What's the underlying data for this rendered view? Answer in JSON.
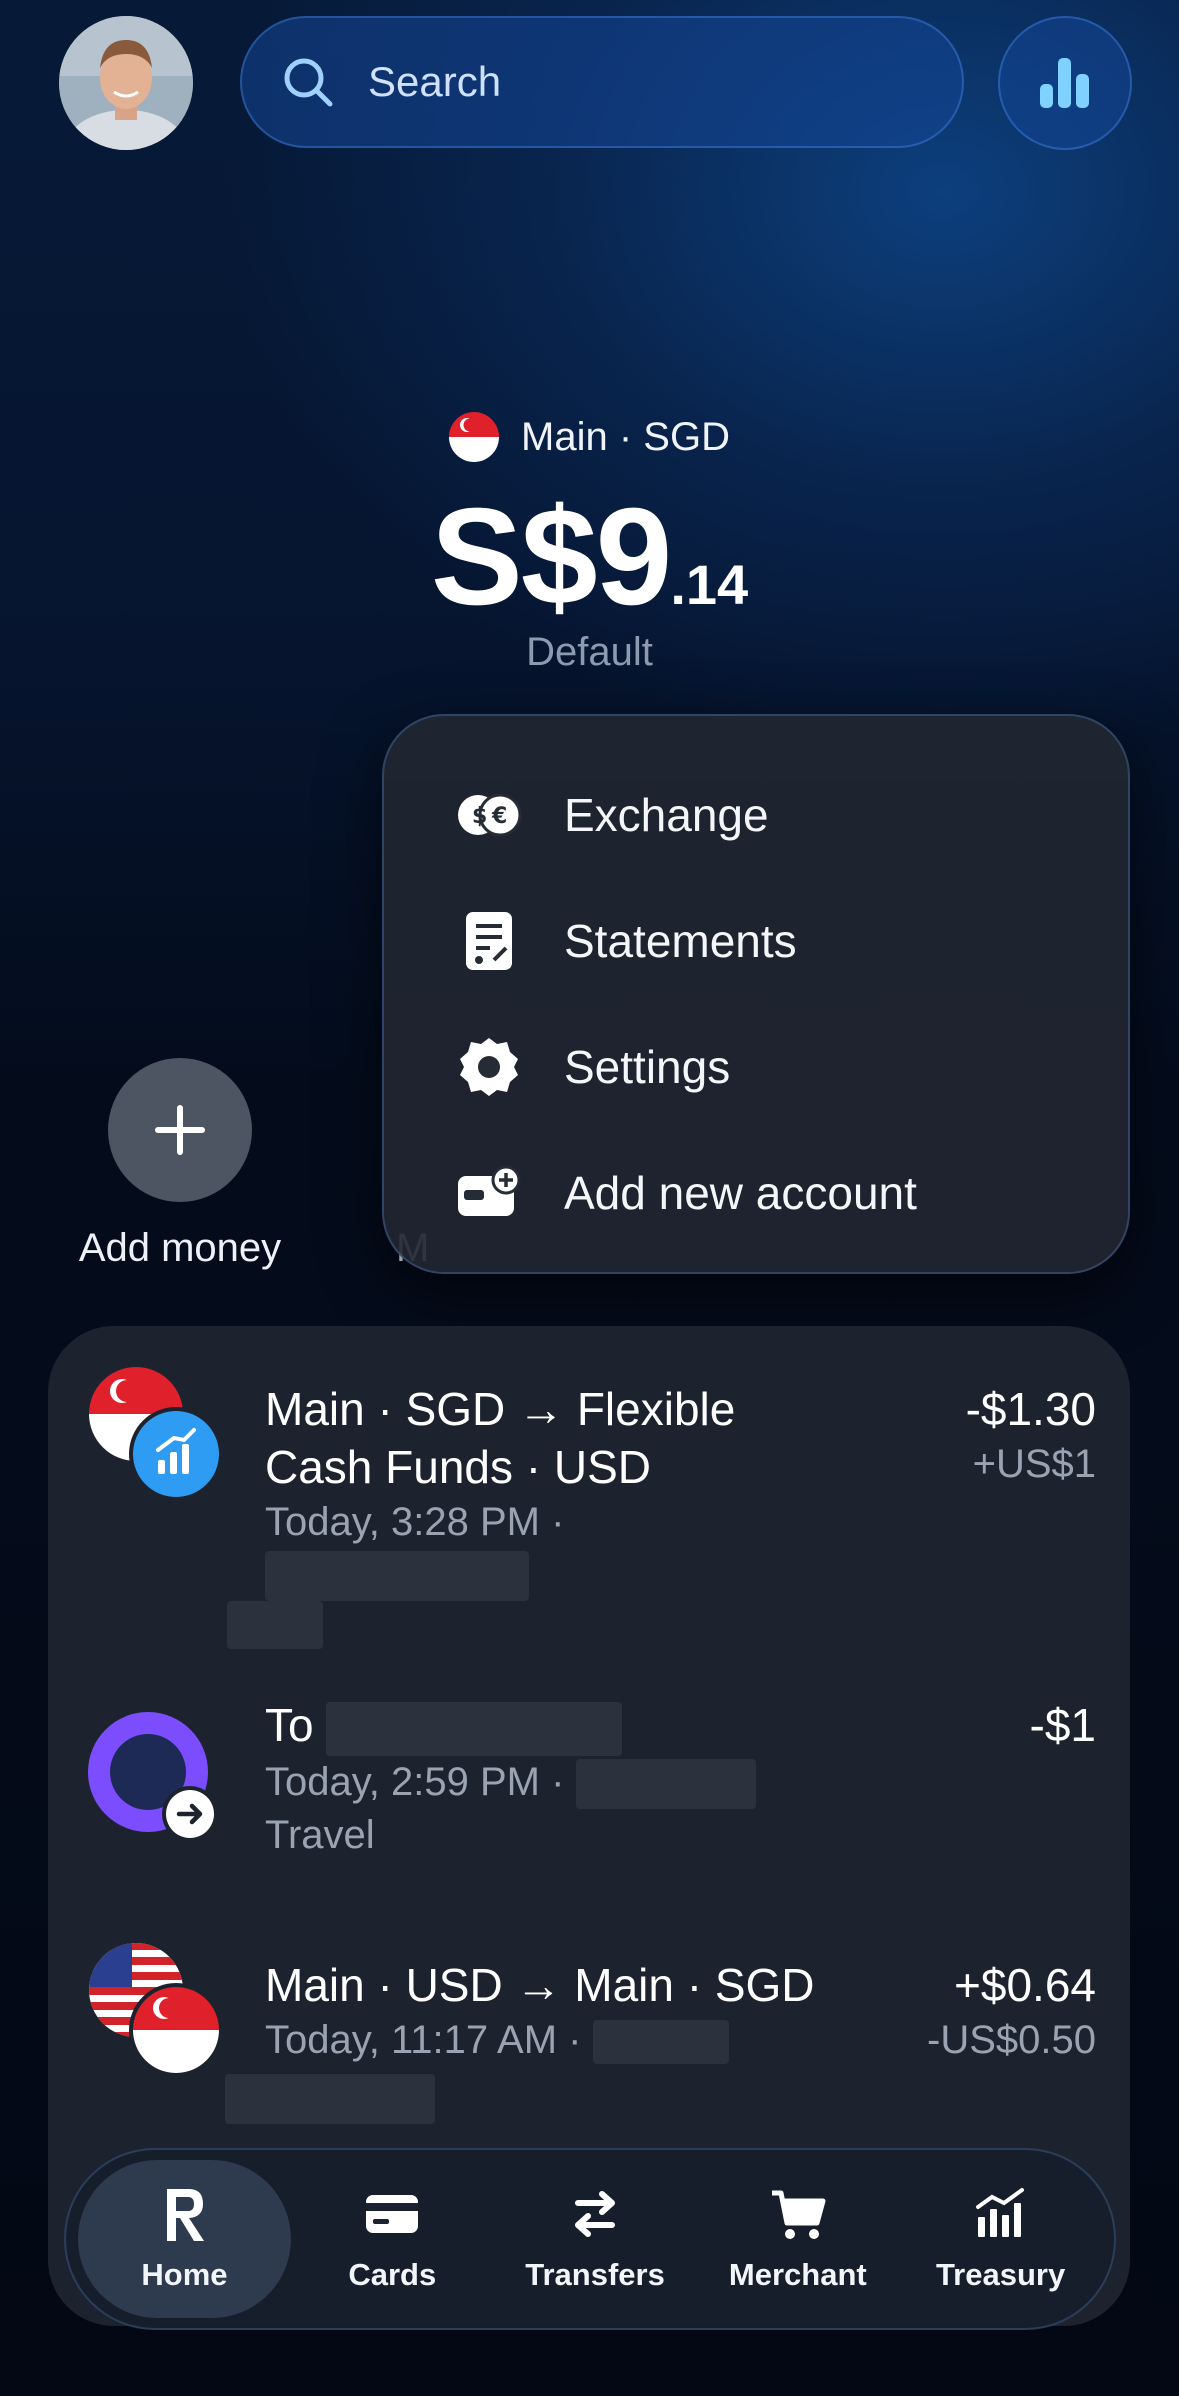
{
  "header": {
    "search_placeholder": "Search"
  },
  "balance": {
    "account_label": "Main · SGD",
    "amount_major": "S$9",
    "amount_minor": ".14",
    "status": "Default"
  },
  "quick_actions": {
    "add_money_label": "Add money",
    "second_label_partial": "M"
  },
  "menu": {
    "items": [
      {
        "label": "Exchange",
        "icon": "exchange-icon"
      },
      {
        "label": "Statements",
        "icon": "statements-icon"
      },
      {
        "label": "Settings",
        "icon": "gear-icon"
      },
      {
        "label": "Add new account",
        "icon": "add-account-icon"
      }
    ]
  },
  "transactions": [
    {
      "title_line1": "Main · SGD → Flexible",
      "title_line2": "Cash Funds · USD",
      "subtitle": "Today, 3:28 PM ·",
      "amount": "-$1.30",
      "amount_secondary": "+US$1"
    },
    {
      "title": "To",
      "subtitle": "Today, 2:59 PM ·",
      "category": "Travel",
      "amount": "-$1"
    },
    {
      "title": "Main · USD → Main · SGD",
      "subtitle": "Today, 11:17 AM ·",
      "amount": "+$0.64",
      "amount_secondary": "-US$0.50"
    }
  ],
  "nav": {
    "items": [
      {
        "label": "Home",
        "active": true
      },
      {
        "label": "Cards",
        "active": false
      },
      {
        "label": "Transfers",
        "active": false
      },
      {
        "label": "Merchant",
        "active": false
      },
      {
        "label": "Treasury",
        "active": false
      }
    ]
  },
  "colors": {
    "accent_blue": "#3aa0ff",
    "sg_red": "#e0202a",
    "purple": "#7b4dff"
  }
}
